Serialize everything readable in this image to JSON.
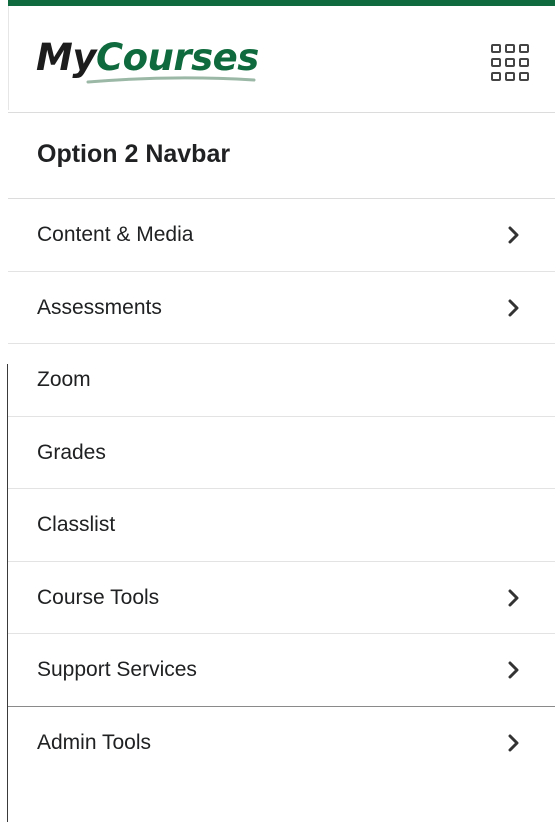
{
  "app": {
    "accent_color": "#0f6b3d",
    "logo": {
      "part1": "My",
      "part2": "Courses"
    },
    "waffle_icon": "app-grid-icon"
  },
  "nav": {
    "title": "Option 2 Navbar",
    "items": [
      {
        "label": "Content & Media",
        "has_submenu": true,
        "icon": "chevron-right-icon"
      },
      {
        "label": "Assessments",
        "has_submenu": true,
        "icon": "chevron-right-icon"
      },
      {
        "label": "Zoom",
        "has_submenu": false
      },
      {
        "label": "Grades",
        "has_submenu": false
      },
      {
        "label": "Classlist",
        "has_submenu": false
      },
      {
        "label": "Course Tools",
        "has_submenu": true,
        "icon": "chevron-right-icon"
      },
      {
        "label": "Support Services",
        "has_submenu": true,
        "icon": "chevron-right-icon"
      },
      {
        "label": "Admin Tools",
        "has_submenu": true,
        "icon": "chevron-right-icon"
      }
    ]
  }
}
